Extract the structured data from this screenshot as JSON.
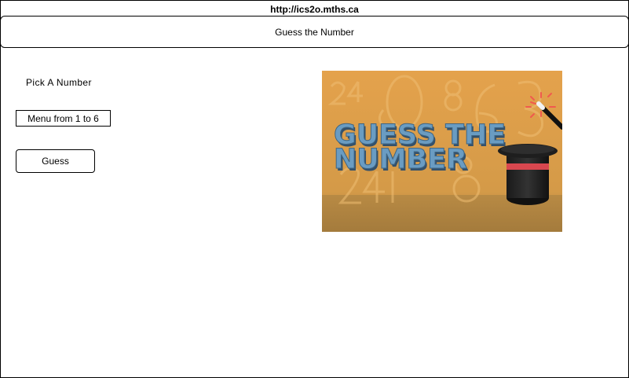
{
  "browser": {
    "url": "http://ics2o.mths.ca"
  },
  "header": {
    "title": "Guess the Number"
  },
  "main": {
    "pick_label": "Pick  A  Number",
    "select": {
      "selected": "Menu from 1 to 6"
    },
    "guess_button_label": "Guess"
  },
  "image": {
    "title_line1": "GUESS THE",
    "title_line2": "NUMBER",
    "icon": "magic-hat-wand",
    "colors": {
      "background": "#e2a24a",
      "title_fill": "#6a9cc2",
      "title_shadow": "#33506a",
      "hat_band": "#d9474f",
      "sparkle": "#f05a4e"
    }
  }
}
